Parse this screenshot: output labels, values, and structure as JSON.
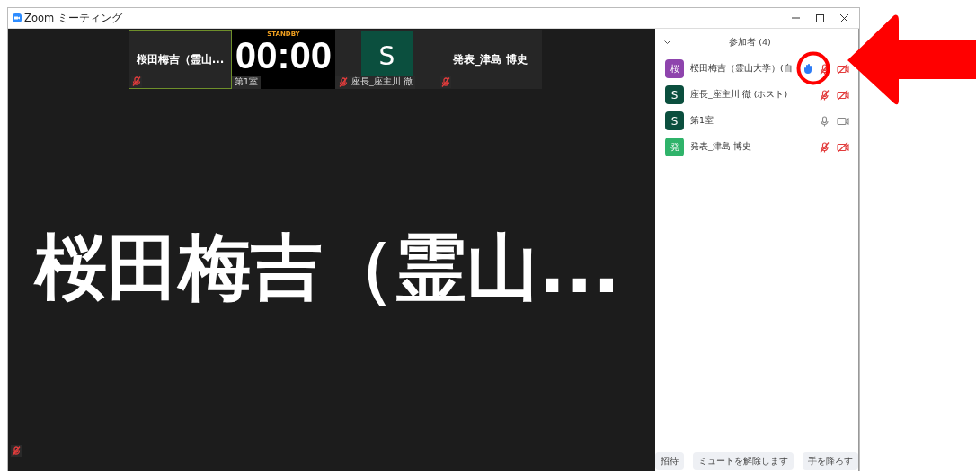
{
  "window": {
    "title": "Zoom ミーティング"
  },
  "thumbnails": [
    {
      "kind": "name",
      "name": "桜田梅吉（霊山...",
      "selected": true,
      "muted": true
    },
    {
      "kind": "timer",
      "status": "STANDBY",
      "time": "00:00",
      "label": "第1室",
      "selected": false
    },
    {
      "kind": "avatar",
      "letter": "S",
      "color": "#0b4f3e",
      "label": "座長_座主川 徹",
      "selected": false,
      "muted": true
    },
    {
      "kind": "name",
      "name": "発表_津島 博史",
      "selected": false,
      "muted": true
    }
  ],
  "speaker": {
    "name": "桜田梅吉（霊山...",
    "muted": true
  },
  "panel": {
    "title": "参加者 (4)",
    "expanded": true,
    "participants": [
      {
        "avatar": "桜",
        "color": "#8e44ad",
        "name": "桜田梅吉（霊山大学）(自",
        "hand_raised": true,
        "muted": true,
        "video_off": true
      },
      {
        "avatar": "S",
        "color": "#0b4f3e",
        "name": "座長_座主川 徹 (ホスト)",
        "hand_raised": false,
        "muted": true,
        "video_off": true
      },
      {
        "avatar": "S",
        "color": "#0b4f3e",
        "name": "第1室",
        "hand_raised": false,
        "muted": false,
        "video_off": false
      },
      {
        "avatar": "発",
        "color": "#2fb36a",
        "name": "発表_津島 博史",
        "hand_raised": false,
        "muted": true,
        "video_off": true
      }
    ],
    "buttons": [
      "招待",
      "ミュートを解除します",
      "手を降ろす"
    ]
  },
  "annotations": {
    "highlight_circle": true,
    "pointer_arrow": true
  }
}
